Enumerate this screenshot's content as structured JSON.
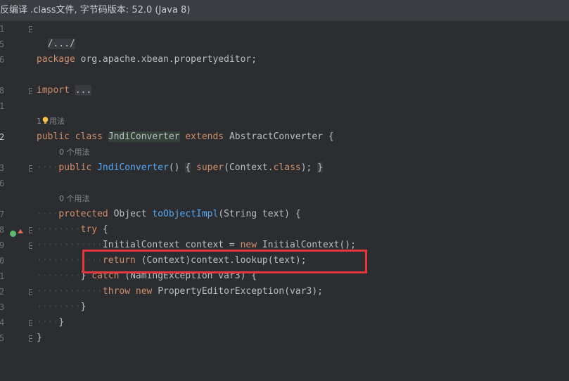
{
  "banner": {
    "text": "反编译 .class文件, 字节码版本: 52.0 (Java 8)"
  },
  "gutter": {
    "line_numbers": [
      "1",
      "5",
      "6",
      "8",
      "1",
      "2",
      "3",
      "6",
      "7",
      "8",
      "9",
      "0",
      "1",
      "2",
      "3",
      "4",
      "5"
    ]
  },
  "code": {
    "l1": "/.../",
    "l5_kw": "package",
    "l5_rest": " org.apache.xbean.propertyeditor;",
    "l8_kw": "import",
    "l8_fold": "...",
    "usage1_count": "1",
    "usage1_label": "用法",
    "class_public": "public",
    "class_class": "class",
    "class_name": "JndiConverter",
    "class_extends": "extends",
    "class_super": "AbstractConverter {",
    "usage2": "0 个用法",
    "ctor_public": "public",
    "ctor_name": "JndiConverter",
    "ctor_parens": "()",
    "ctor_open": "{",
    "ctor_super": "super",
    "ctor_args": "(Context.",
    "ctor_class_kw": "class",
    "ctor_end": ");",
    "ctor_close": "}",
    "usage3": "0 个用法",
    "m_protected": "protected",
    "m_type": "Object",
    "m_name": "toObjectImpl",
    "m_params": "(String text) {",
    "try_kw": "try",
    "try_brace": " {",
    "ctx_decl": "InitialContext context = ",
    "ctx_new": "new",
    "ctx_ctor": " InitialContext();",
    "ret_kw": "return",
    "ret_rest": " (Context)context.lookup(text);",
    "catch_close": "} ",
    "catch_kw": "catch",
    "catch_rest": " (NamingException var3) {",
    "throw_kw": "throw",
    "throw_new": "new",
    "throw_rest": " PropertyEditorException(var3);",
    "close_inner": "}",
    "close_method": "}",
    "close_class": "}"
  },
  "colors": {
    "keyword": "#cf8e6d",
    "function": "#56a8f5",
    "text": "#bcbec4",
    "highlight_box": "#e2373f"
  },
  "icons": [
    "bulb-icon",
    "implements-icon",
    "fold-icon"
  ]
}
